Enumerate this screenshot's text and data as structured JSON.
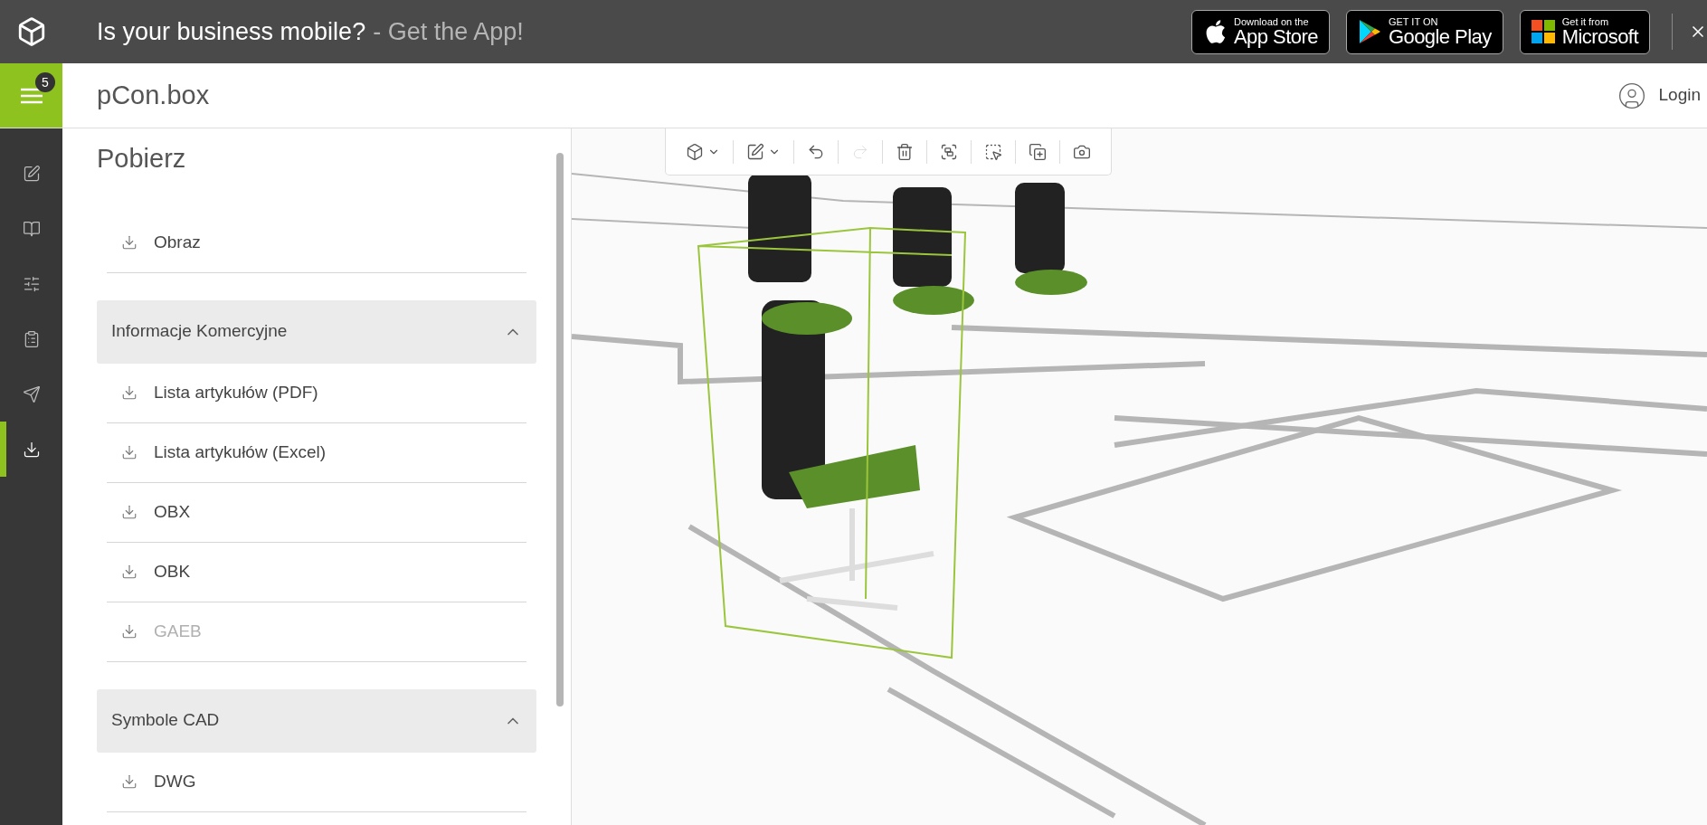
{
  "promo_bar": {
    "headline": "Is your business mobile?",
    "call_to_action": "- Get the App!",
    "store_badges": [
      {
        "kind": "apple",
        "small_text": "Download on the",
        "store": "App Store"
      },
      {
        "kind": "google",
        "small_text": "GET IT ON",
        "store": "Google Play"
      },
      {
        "kind": "microsoft",
        "small_text": "Get it from",
        "store": "Microsoft"
      }
    ]
  },
  "header": {
    "menu_badge": "5",
    "app_title": "pCon.box",
    "login": "Login"
  },
  "rail": [
    {
      "kind": "edit",
      "selected": false
    },
    {
      "kind": "catalog",
      "selected": false
    },
    {
      "kind": "sliders",
      "selected": false
    },
    {
      "kind": "list",
      "selected": false
    },
    {
      "kind": "send",
      "selected": false
    },
    {
      "kind": "download",
      "selected": true
    }
  ],
  "panel": {
    "title": "Pobierz",
    "items": [
      {
        "label": "Obraz",
        "disabled": false
      }
    ],
    "sections": [
      {
        "title": "Informacje Komercyjne",
        "expanded": true,
        "items": [
          {
            "label": "Lista artykułów (PDF)",
            "disabled": false
          },
          {
            "label": "Lista artykułów (Excel)",
            "disabled": false
          },
          {
            "label": "OBX",
            "disabled": false
          },
          {
            "label": "OBK",
            "disabled": false
          },
          {
            "label": "GAEB",
            "disabled": true
          }
        ]
      },
      {
        "title": "Symbole CAD",
        "expanded": true,
        "items": [
          {
            "label": "DWG",
            "disabled": false
          }
        ]
      }
    ]
  },
  "toolbar": [
    {
      "kind": "view",
      "dropdown": true,
      "disabled": false
    },
    {
      "kind": "edit",
      "dropdown": true,
      "disabled": false
    },
    {
      "kind": "undo",
      "dropdown": false,
      "disabled": false
    },
    {
      "kind": "redo",
      "dropdown": false,
      "disabled": true
    },
    {
      "kind": "delete",
      "dropdown": false,
      "disabled": false
    },
    {
      "kind": "group",
      "dropdown": false,
      "disabled": false
    },
    {
      "kind": "select",
      "dropdown": false,
      "disabled": false
    },
    {
      "kind": "duplicate",
      "dropdown": false,
      "disabled": false
    },
    {
      "kind": "camera",
      "dropdown": false,
      "disabled": false
    }
  ]
}
